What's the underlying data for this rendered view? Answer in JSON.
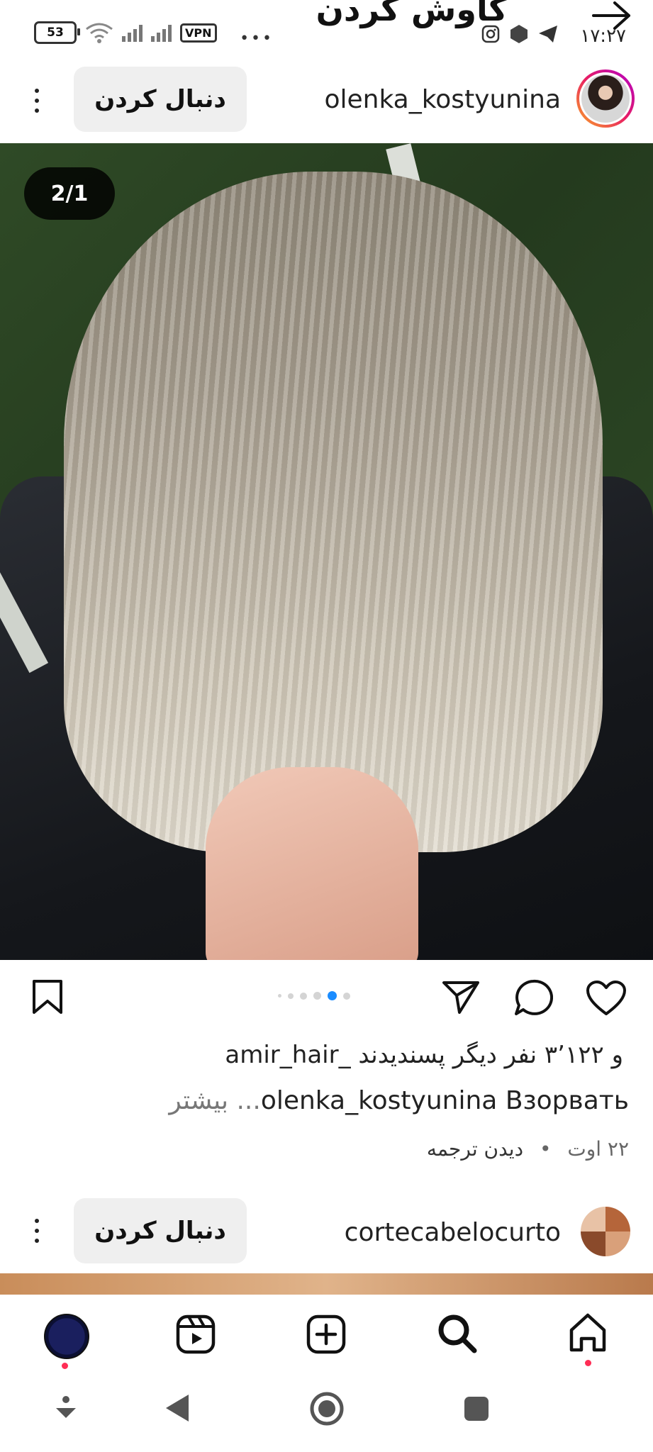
{
  "status_bar": {
    "time": "۱۷:۲۷",
    "battery": "53",
    "vpn": "VPN"
  },
  "top_bar": {
    "title": "کاوش کردن"
  },
  "post1": {
    "username": "olenka_kostyunina",
    "follow_label": "دنبال کردن",
    "slide_counter": "2/1",
    "carousel_count": 6,
    "carousel_active_index": 4,
    "likes_text": "و ۳٬۱۲۲ نفر دیگر پسندیدند _amir_hair",
    "caption_user": "olenka_kostyunina",
    "caption_text": "Взорвать",
    "caption_more": "... بیشتر",
    "date": "۲۲ اوت",
    "translate": "دیدن ترجمه",
    "separator": "•"
  },
  "post2": {
    "username": "cortecabelocurto",
    "follow_label": "دنبال کردن"
  },
  "bottom_nav": {
    "items": [
      "profile-icon",
      "reels-icon",
      "create-icon",
      "search-icon",
      "home-icon"
    ]
  },
  "colors": {
    "accent": "#1a8cff",
    "notification": "#ff2d55",
    "follow_bg": "#efefef"
  }
}
